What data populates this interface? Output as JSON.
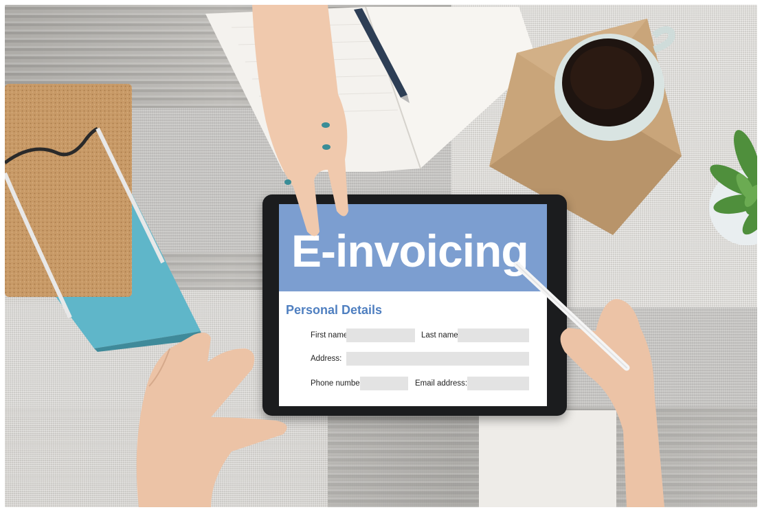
{
  "screen": {
    "banner_title": "E-invoicing",
    "section_title": "Personal Details",
    "form": {
      "first_name_label": "First name:",
      "last_name_label": "Last name:",
      "address_label": "Address:",
      "phone_label": "Phone number:",
      "email_label": "Email address:",
      "first_name_value": "",
      "last_name_value": "",
      "address_value": "",
      "phone_value": "",
      "email_value": ""
    }
  },
  "colors": {
    "banner": "#7c9ed0",
    "section_title": "#4f7fc0",
    "field": "#e3e3e3",
    "tablet_frame": "#1b1c1e"
  }
}
